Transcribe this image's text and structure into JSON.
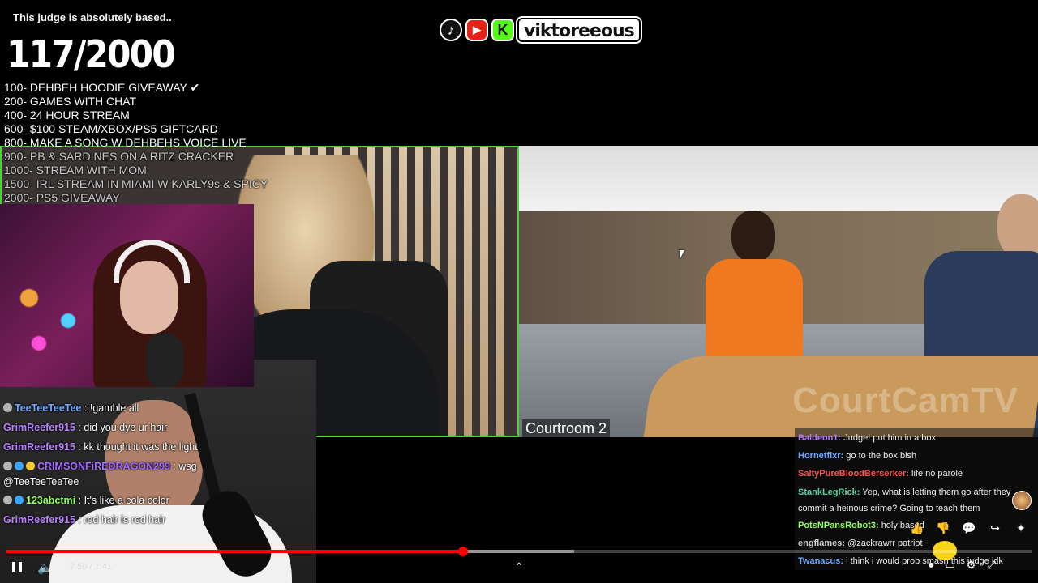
{
  "overlay": {
    "title": "This judge is absolutely based..",
    "counter": "117/2000",
    "goals": [
      "100- DEHBEH HOODIE GIVEAWAY ✔",
      "200- GAMES WITH CHAT",
      "400- 24 HOUR STREAM",
      "600- $100 STEAM/XBOX/PS5 GIFTCARD",
      "800- MAKE A SONG W DEHBEHS VOICE LIVE",
      "900- PB & SARDINES ON A RITZ CRACKER",
      "1000- STREAM WITH MOM",
      "1500- IRL STREAM IN MIAMI W KARLY9s & SPICY",
      "2000- PS5 GIVEAWAY"
    ]
  },
  "social": {
    "handle": "viktoreeous",
    "icons": [
      "tiktok-icon",
      "youtube-icon",
      "kick-icon"
    ],
    "kick_letter": "K"
  },
  "stream": {
    "room_label": "Courtroom 2",
    "watermark": "CourtCamTV",
    "frame_color": "#4cd137"
  },
  "chat_left": [
    {
      "user": "TeeTeeTeeTee",
      "color": "#6ea8ff",
      "message": "!gamble all",
      "badges": 1
    },
    {
      "user": "GrimReefer915",
      "color": "#b982ff",
      "message": "did you dye ur hair",
      "badges": 0
    },
    {
      "user": "GrimReefer915",
      "color": "#b982ff",
      "message": "kk thought it was the light",
      "badges": 0
    },
    {
      "user": "CRIMSONFiREDRAGON299",
      "color": "#a76bff",
      "message": "wsg",
      "badges": 3
    },
    {
      "user": "",
      "color": "#ffffff",
      "message": "@TeeTeeTeeTee",
      "badges": 0,
      "continuation": true
    },
    {
      "user": "123abctmi",
      "color": "#8fff5a",
      "message": "It's like a cola color",
      "badges": 2
    },
    {
      "user": "GrimReefer915",
      "color": "#b982ff",
      "message": "red hair is red hair",
      "badges": 0
    }
  ],
  "chat_right": [
    {
      "user": "Baldeon1:",
      "color": "#b37bff",
      "message": "Judge! put him in a box"
    },
    {
      "user": "Hornetfixr:",
      "color": "#6ea8ff",
      "message": "go to the box bish"
    },
    {
      "user": "SaltyPureBloodBerserker:",
      "color": "#ff5050",
      "message": "life no parole"
    },
    {
      "user": "StankLegRick:",
      "color": "#5ad1a0",
      "message": "Yep, what is letting them go after they commit a heinous crime? Going to teach them",
      "wrap": true
    },
    {
      "user": "PotsNPansRobot3:",
      "color": "#8fff5a",
      "message": "holy based"
    },
    {
      "user": "engflames:",
      "color": "#cfcfcf",
      "message": "@zackrawrr patriot"
    },
    {
      "user": "Twanacus:",
      "color": "#6ea8ff",
      "message": "i think i would prob smash this judge idk"
    }
  ],
  "player": {
    "timecode": "7:50 / 1:41",
    "progress_played": 0.4453,
    "progress_buffered": 0.554,
    "colors": {
      "progress": "#ff0000"
    },
    "expand_icon": "chevron-up-icon"
  },
  "actions": {
    "like": "👍",
    "dislike": "👎",
    "comment": "💬",
    "share": "↪",
    "remix": "✦"
  }
}
